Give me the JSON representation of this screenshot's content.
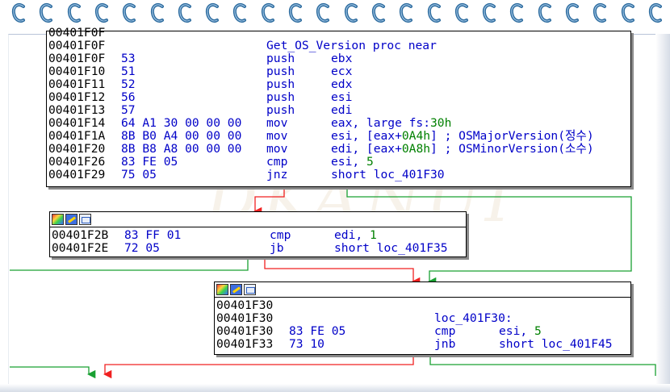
{
  "colors": {
    "true_edge": "#19a032",
    "false_edge": "#f02020",
    "instruction": "#0000c8",
    "immediate": "#008000",
    "ring": "#2c6b9e"
  },
  "watermark": "DKANUI",
  "block1": {
    "lines": [
      {
        "addr": "00401F0F",
        "bytes": "",
        "mn": "",
        "op": "",
        "label": ""
      },
      {
        "addr": "00401F0F",
        "bytes": "",
        "mn": "",
        "op": "",
        "label": "Get_OS_Version proc near"
      },
      {
        "addr": "00401F0F",
        "bytes": "53",
        "mn": "push",
        "op": "ebx"
      },
      {
        "addr": "00401F10",
        "bytes": "51",
        "mn": "push",
        "op": "ecx"
      },
      {
        "addr": "00401F11",
        "bytes": "52",
        "mn": "push",
        "op": "edx"
      },
      {
        "addr": "00401F12",
        "bytes": "56",
        "mn": "push",
        "op": "esi"
      },
      {
        "addr": "00401F13",
        "bytes": "57",
        "mn": "push",
        "op": "edi"
      },
      {
        "addr": "00401F14",
        "bytes": "64 A1 30 00 00 00",
        "mn": "mov",
        "op": "eax, large fs:",
        "imm": "30h"
      },
      {
        "addr": "00401F1A",
        "bytes": "8B B0 A4 00 00 00",
        "mn": "mov",
        "op": "esi, [eax+",
        "imm": "0A4h",
        "op2": "]",
        "cm": " ; OSMajorVersion(정수)"
      },
      {
        "addr": "00401F20",
        "bytes": "8B B8 A8 00 00 00",
        "mn": "mov",
        "op": "edi, [eax+",
        "imm": "0A8h",
        "op2": "]",
        "cm": " ; OSMinorVersion(소수)"
      },
      {
        "addr": "00401F26",
        "bytes": "83 FE 05",
        "mn": "cmp",
        "op": "esi, ",
        "imm": "5"
      },
      {
        "addr": "00401F29",
        "bytes": "75 05",
        "mn": "jnz",
        "op": "short loc_401F30"
      }
    ]
  },
  "block2": {
    "lines": [
      {
        "addr": "00401F2B",
        "bytes": "83 FF 01",
        "mn": "cmp",
        "op": "edi, ",
        "imm": "1"
      },
      {
        "addr": "00401F2E",
        "bytes": "72 05",
        "mn": "jb",
        "op": "short loc_401F35"
      }
    ]
  },
  "block3": {
    "lines": [
      {
        "addr": "00401F30",
        "bytes": "",
        "mn": "",
        "op": ""
      },
      {
        "addr": "00401F30",
        "bytes": "",
        "mn": "",
        "op": "",
        "label": "loc_401F30:"
      },
      {
        "addr": "00401F30",
        "bytes": "83 FE 05",
        "mn": "cmp",
        "op": "esi, ",
        "imm": "5"
      },
      {
        "addr": "00401F33",
        "bytes": "73 10",
        "mn": "jnb",
        "op": "short loc_401F45"
      }
    ]
  }
}
